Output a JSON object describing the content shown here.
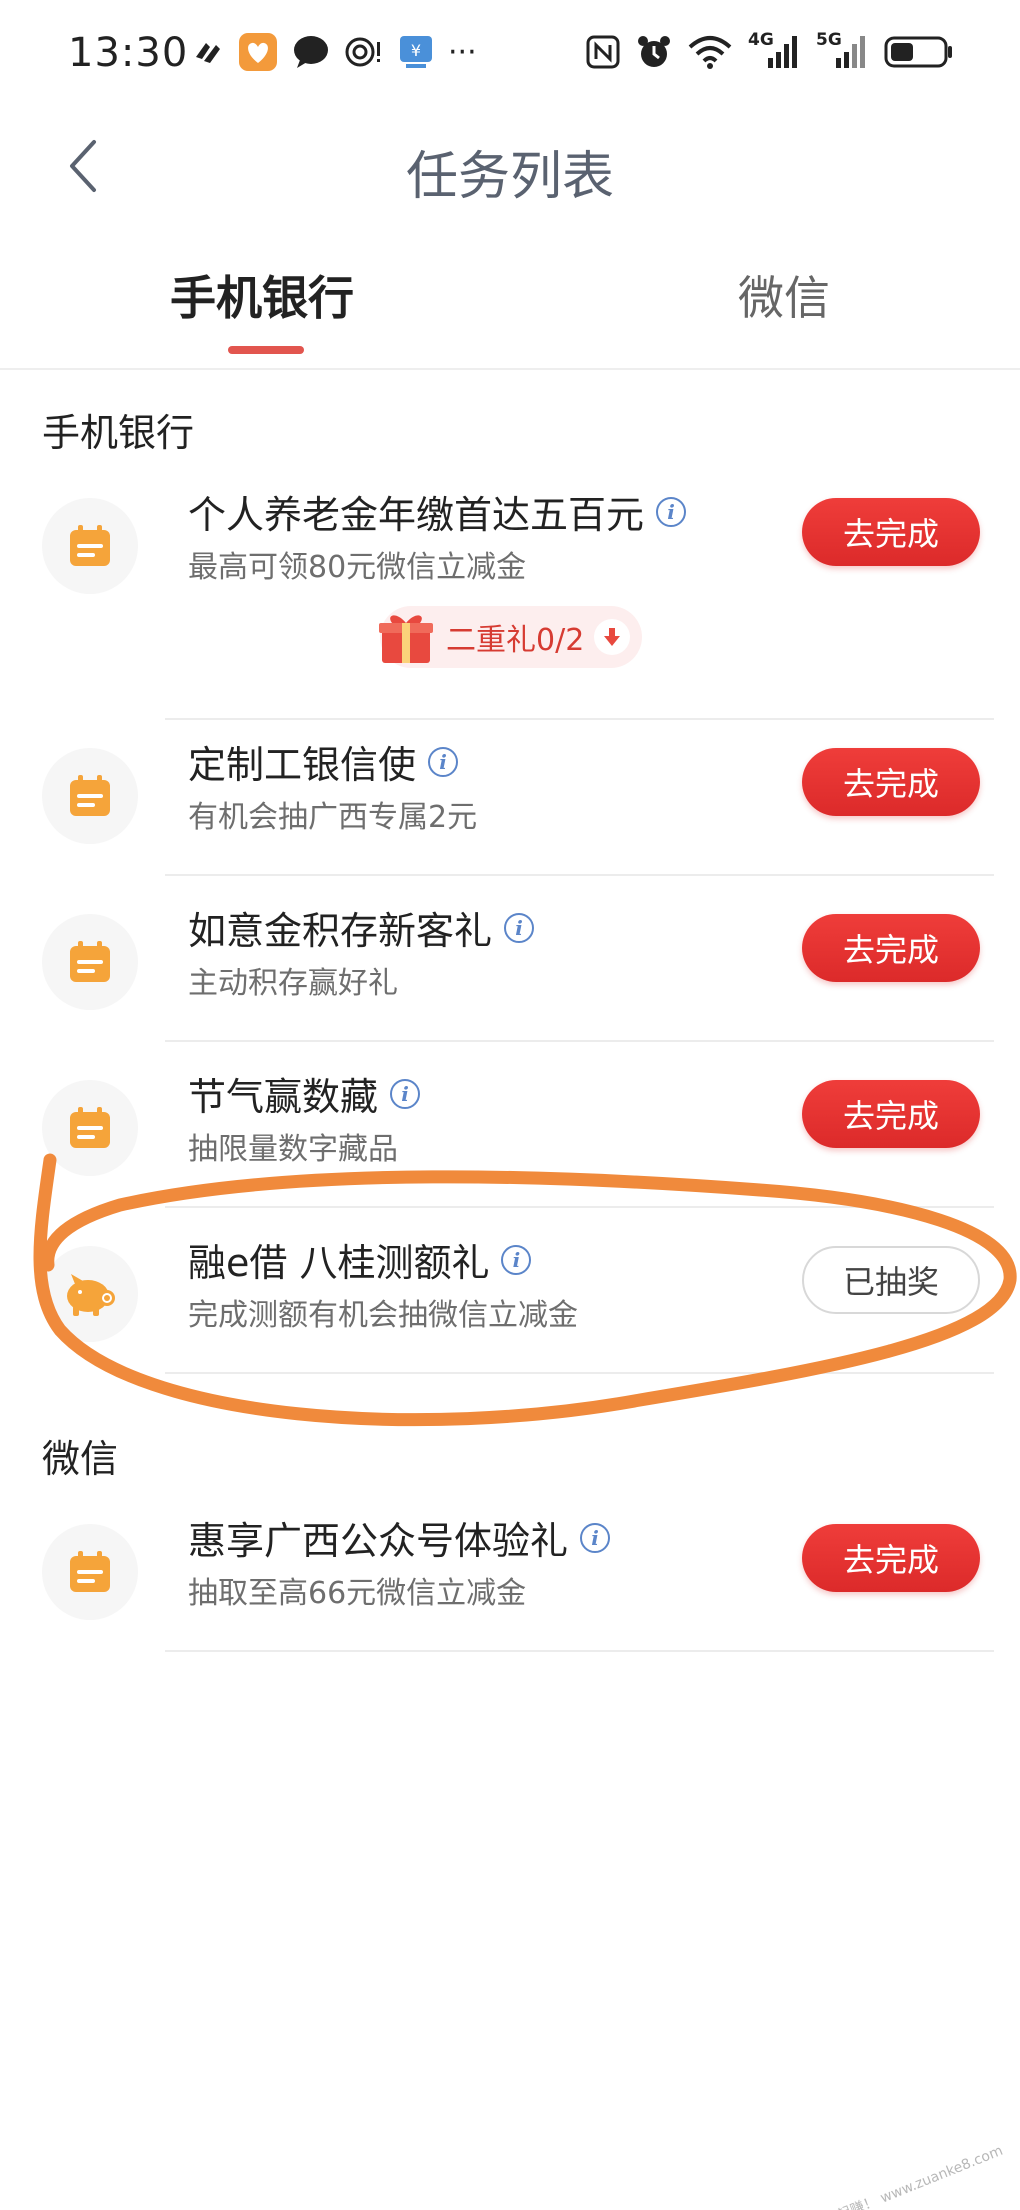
{
  "status_bar": {
    "time": "13:30",
    "network_4g": "4G",
    "network_5g": "5G",
    "more": "···"
  },
  "nav": {
    "title": "任务列表"
  },
  "tabs": [
    {
      "label": "手机银行",
      "active": true
    },
    {
      "label": "微信",
      "active": false
    }
  ],
  "sections": [
    {
      "title": "手机银行",
      "tasks": [
        {
          "title": "个人养老金年缴首达五百元",
          "subtitle": "最高可领80元微信立减金",
          "button": "去完成",
          "icon": "calendar-icon"
        },
        {
          "title": "定制工银信使",
          "subtitle": "有机会抽广西专属2元",
          "button": "去完成",
          "icon": "calendar-icon"
        },
        {
          "title": "如意金积存新客礼",
          "subtitle": "主动积存赢好礼",
          "button": "去完成",
          "icon": "calendar-icon"
        },
        {
          "title": "节气赢数藏",
          "subtitle": "抽限量数字藏品",
          "button": "去完成",
          "icon": "calendar-icon"
        },
        {
          "title": "融e借 八桂测额礼",
          "subtitle": "完成测额有机会抽微信立减金",
          "button": "已抽奖",
          "icon": "piggy-bank-icon"
        }
      ]
    },
    {
      "title": "微信",
      "tasks": [
        {
          "title": "惠享广西公众号体验礼",
          "subtitle": "抽取至高66元微信立减金",
          "button": "去完成",
          "icon": "calendar-icon"
        }
      ]
    }
  ],
  "gift_badge": {
    "label": "二重礼0/2"
  },
  "watermark": "赚客吧，有奖一起赚！ www.zuanke8.com",
  "colors": {
    "accent_red": "#e53935",
    "icon_orange": "#f5a43a",
    "annotation_orange": "#f08a3c",
    "info_blue": "#5b85c9"
  }
}
